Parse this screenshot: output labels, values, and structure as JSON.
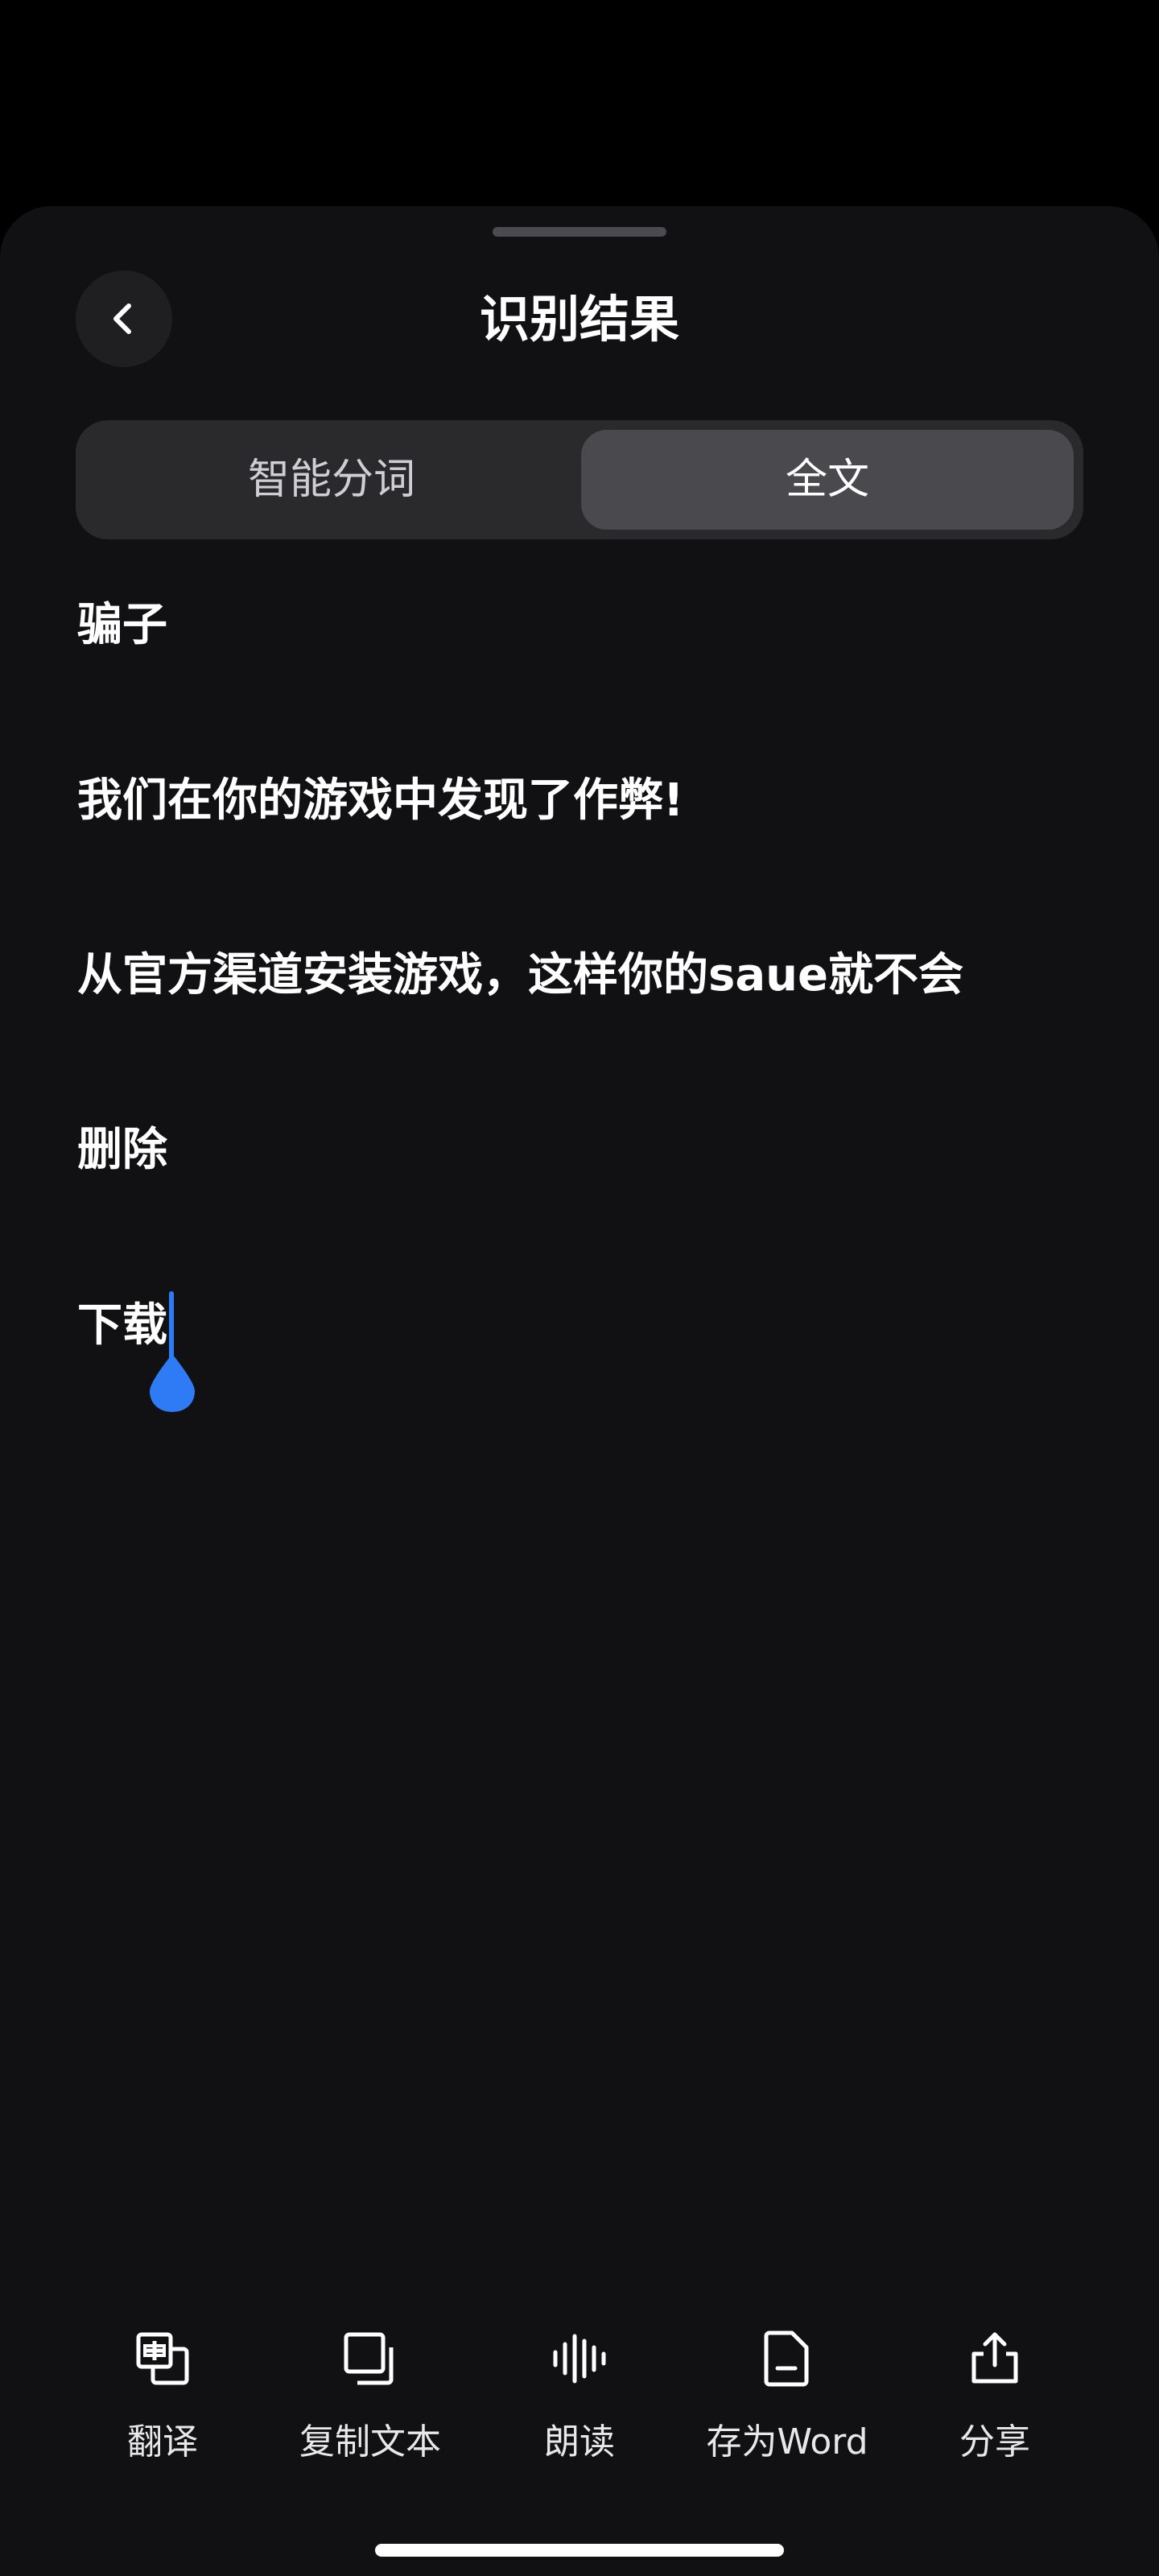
{
  "header": {
    "title": "识别结果"
  },
  "tabs": [
    {
      "label": "智能分词",
      "selected": false
    },
    {
      "label": "全文",
      "selected": true
    }
  ],
  "content": {
    "lines": [
      "骗子",
      "我们在你的游戏中发现了作弊!",
      "从官方渠道安装游戏，这样你的saue就不会",
      "删除",
      "下载"
    ]
  },
  "toolbar": {
    "items": [
      {
        "label": "翻译",
        "icon": "translate-icon"
      },
      {
        "label": "复制文本",
        "icon": "copy-icon"
      },
      {
        "label": "朗读",
        "icon": "waveform-icon"
      },
      {
        "label": "存为Word",
        "icon": "document-icon"
      },
      {
        "label": "分享",
        "icon": "share-icon"
      }
    ]
  },
  "colors": {
    "background": "#111113",
    "accent": "#2f7bf6",
    "segment_selected": "#4a4a4e"
  }
}
